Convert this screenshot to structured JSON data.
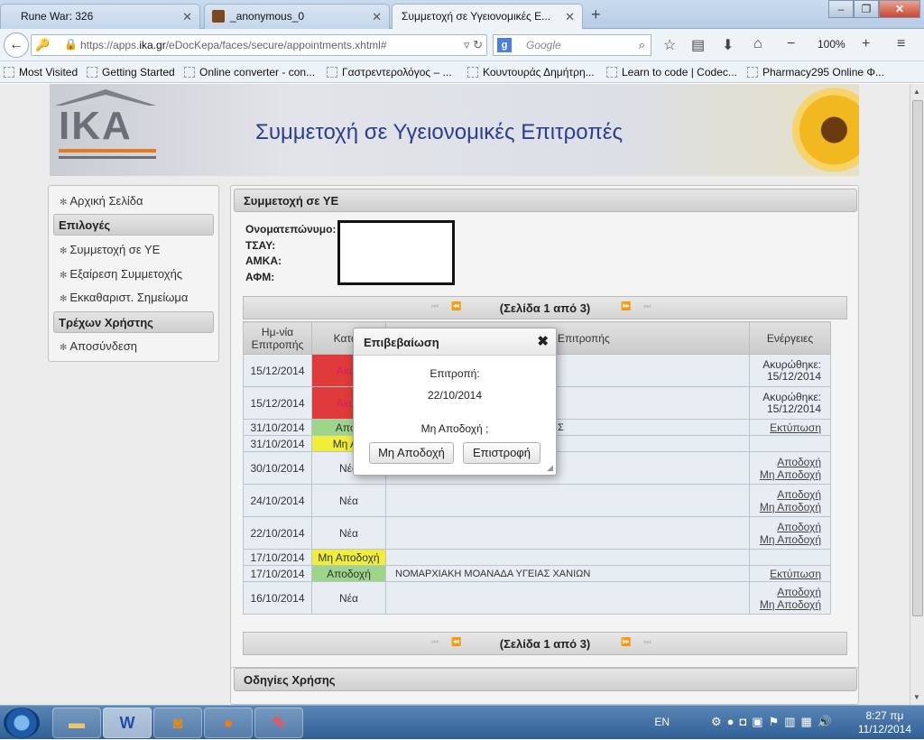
{
  "browser": {
    "tabs": [
      {
        "label": "Rune War: 326"
      },
      {
        "label": "_anonymous_0"
      },
      {
        "label": "Συμμετοχή σε Υγειονομικές Ε..."
      }
    ],
    "url_prefix": "https://apps.",
    "url_domain": "ika.gr",
    "url_rest": "/eDocKepa/faces/secure/appointments.xhtml#",
    "search_placeholder": "Google",
    "zoom": "100%",
    "bookmarks": [
      "Most Visited",
      "Getting Started",
      "Online converter - con...",
      "Γαστρεντερολόγος – ...",
      "Κουντουράς Δημήτρη...",
      "Learn to code | Codec...",
      "Pharmacy295 Online Φ..."
    ]
  },
  "banner": {
    "logo_text": "IKA",
    "title": "Συμμετοχή σε Υγειονομικές Επιτροπές"
  },
  "menu": {
    "home": "Αρχική Σελίδα",
    "options_header": "Επιλογές",
    "participation": "Συμμετοχή σε ΥΕ",
    "exemption": "Εξαίρεση Συμμετοχής",
    "clearance": "Εκκαθαριστ. Σημείωμα",
    "user_header": "Τρέχων Χρήστης",
    "logout": "Αποσύνδεση"
  },
  "main": {
    "header": "Συμμετοχή σε ΥΕ",
    "labels": [
      "Ονοματεπώνυμο:",
      "ΤΣΑΥ:",
      "ΑΜΚΑ:",
      "ΑΦΜ:"
    ],
    "pager_text": "(Σελίδα 1 από 3)",
    "columns": {
      "date": "Ημ-νία Επιτροπής",
      "status": "Κατάσ",
      "committee": "Επιτροπής",
      "actions": "Ενέργειες"
    },
    "rows": [
      {
        "date": "15/12/2014",
        "status": "Ακυρ",
        "name": "",
        "act1": "Ακυρώθηκε:",
        "act2": "15/12/2014"
      },
      {
        "date": "15/12/2014",
        "status": "Ακυρ",
        "name": "",
        "act1": "Ακυρώθηκε:",
        "act2": "15/12/2014"
      },
      {
        "date": "31/10/2014",
        "status": "Αποδ",
        "name": "Σ",
        "act1": "Εκτύπωση",
        "act2": ""
      },
      {
        "date": "31/10/2014",
        "status": "Μη Απ",
        "name": "",
        "act1": "",
        "act2": ""
      },
      {
        "date": "30/10/2014",
        "status": "Νέα",
        "name": "",
        "act1": "Αποδοχή",
        "act2": "Μη Αποδοχή"
      },
      {
        "date": "24/10/2014",
        "status": "Νέα",
        "name": "",
        "act1": "Αποδοχή",
        "act2": "Μη Αποδοχή"
      },
      {
        "date": "22/10/2014",
        "status": "Νέα",
        "name": "",
        "act1": "Αποδοχή",
        "act2": "Μη Αποδοχή"
      },
      {
        "date": "17/10/2014",
        "status": "Μη Αποδοχή",
        "name": "",
        "act1": "",
        "act2": ""
      },
      {
        "date": "17/10/2014",
        "status": "Αποδοχή",
        "name": "ΝΟΜΑΡΧΙΑΚΗ ΜΟΑΝΑΔΑ ΥΓΕΙΑΣ ΧΑΝΙΩΝ",
        "act1": "Εκτύπωση",
        "act2": ""
      },
      {
        "date": "16/10/2014",
        "status": "Νέα",
        "name": "",
        "act1": "Αποδοχή",
        "act2": "Μη Αποδοχή"
      }
    ],
    "guide_header": "Οδηγίες Χρήσης"
  },
  "dialog": {
    "title": "Επιβεβαίωση",
    "committee_label": "Επιτροπή:",
    "committee_date": "22/10/2014",
    "question": "Μη Αποδοχή ;",
    "confirm_button": "Μη Αποδοχή",
    "back_button": "Επιστροφή"
  },
  "taskbar": {
    "word_label": "W",
    "lang": "EN",
    "time": "8:27 πμ",
    "date": "11/12/2014"
  },
  "colors": {
    "cancelled": "#e03a3a",
    "accepted": "#9dd68a",
    "rejected": "#f0ee3a",
    "title_blue": "#2e3d8f"
  }
}
